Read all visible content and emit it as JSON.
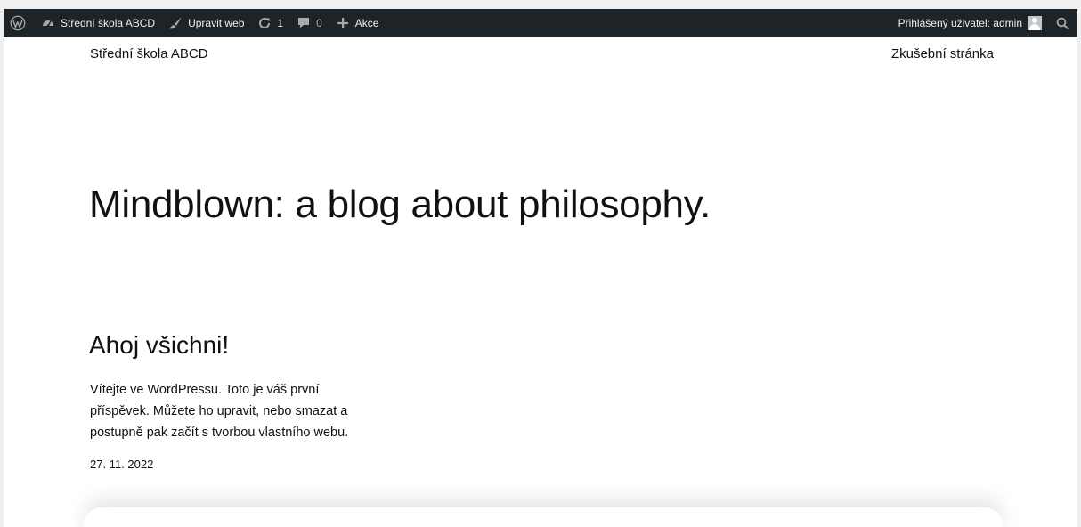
{
  "adminbar": {
    "site_name": "Střední škola ABCD",
    "customize": "Upravit web",
    "updates_count": "1",
    "comments_count": "0",
    "new": "Akce",
    "greeting": "Přihlášený uživatel: admin"
  },
  "header": {
    "site_title": "Střední škola ABCD",
    "nav_link": "Zkušební stránka"
  },
  "hero": {
    "title": "Mindblown: a blog about philosophy."
  },
  "post": {
    "title": "Ahoj všichni!",
    "excerpt": "Vítejte ve WordPressu. Toto je váš první příspěvek. Můžete ho upravit, nebo smazat a postupně pak začít s tvorbou vlastního webu.",
    "date": "27. 11. 2022"
  },
  "icons": [
    "wordpress-icon",
    "dashboard-icon",
    "brush-icon",
    "refresh-icon",
    "comment-icon",
    "plus-icon",
    "avatar",
    "search-icon"
  ]
}
